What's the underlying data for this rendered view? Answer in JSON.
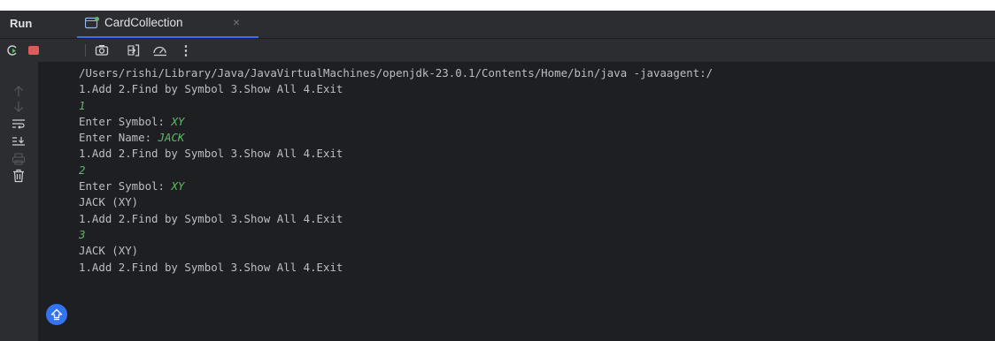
{
  "panel": {
    "label": "Run"
  },
  "tab": {
    "title": "CardCollection",
    "close": "×"
  },
  "toolbar": {
    "more": "⋮"
  },
  "console": {
    "lines": [
      {
        "prefix": "/Users/rishi/Library/Java/JavaVirtualMachines/openjdk-23.0.1/Contents/Home/bin/java -javaagent:/",
        "input": ""
      },
      {
        "prefix": "1.Add 2.Find by Symbol 3.Show All 4.Exit",
        "input": ""
      },
      {
        "prefix": "",
        "input": "1"
      },
      {
        "prefix": "Enter Symbol: ",
        "input": "XY"
      },
      {
        "prefix": "Enter Name: ",
        "input": "JACK"
      },
      {
        "prefix": "1.Add 2.Find by Symbol 3.Show All 4.Exit",
        "input": ""
      },
      {
        "prefix": "",
        "input": "2"
      },
      {
        "prefix": "Enter Symbol: ",
        "input": "XY"
      },
      {
        "prefix": "JACK (XY)",
        "input": ""
      },
      {
        "prefix": "1.Add 2.Find by Symbol 3.Show All 4.Exit",
        "input": ""
      },
      {
        "prefix": "",
        "input": "3"
      },
      {
        "prefix": "JACK (XY)",
        "input": ""
      },
      {
        "prefix": "1.Add 2.Find by Symbol 3.Show All 4.Exit",
        "input": ""
      }
    ]
  },
  "colors": {
    "background": "#1e1f22",
    "panel": "#2b2d30",
    "text": "#bcbec4",
    "user_input": "#5fb865",
    "accent": "#3574f0",
    "stop": "#db5c5c"
  },
  "icons": {
    "tab": "run-config-icon",
    "toolbar": [
      "rerun-icon",
      "stop-icon",
      "screenshot-icon",
      "exit-icon",
      "profiler-icon",
      "more-icon"
    ],
    "gutter": [
      "up-arrow-icon",
      "down-arrow-icon",
      "soft-wrap-icon",
      "scroll-to-end-icon",
      "print-icon",
      "trash-icon"
    ],
    "floating": "scroll-up-icon"
  }
}
